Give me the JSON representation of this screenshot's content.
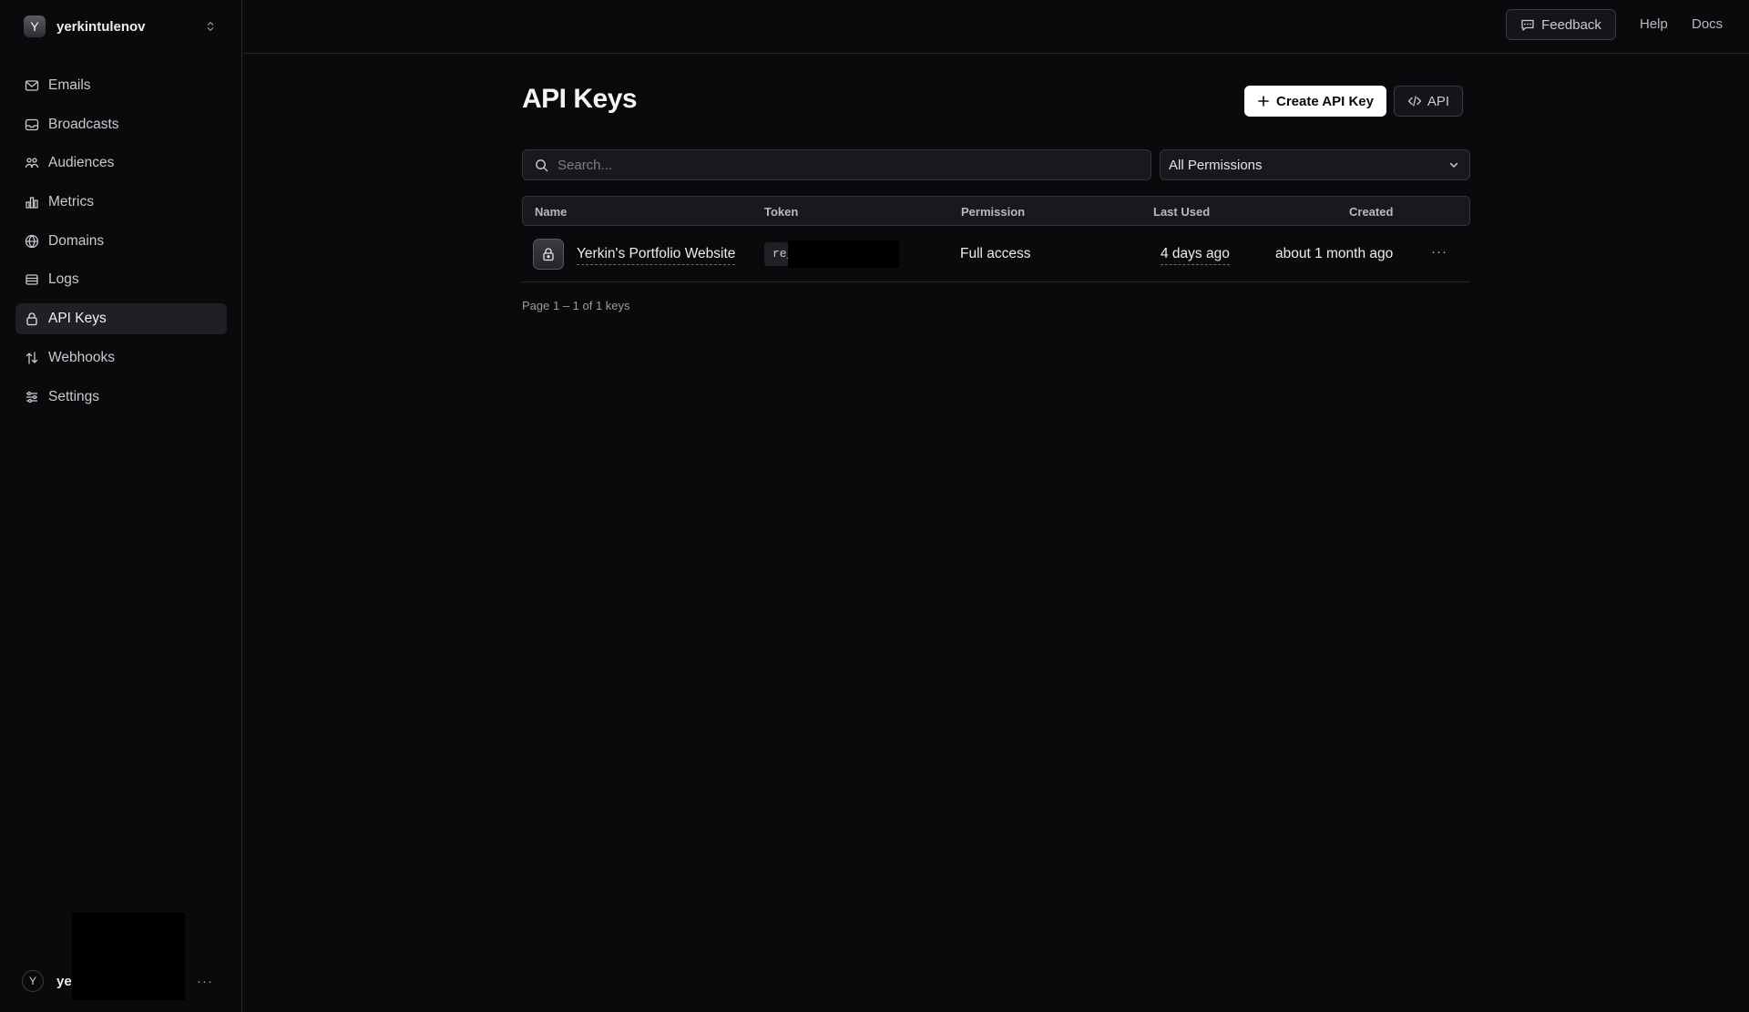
{
  "sidebar": {
    "team_initial": "Y",
    "team_name": "yerkintulenov",
    "items": [
      {
        "label": "Emails",
        "icon": "mail-icon"
      },
      {
        "label": "Broadcasts",
        "icon": "inbox-icon"
      },
      {
        "label": "Audiences",
        "icon": "users-icon"
      },
      {
        "label": "Metrics",
        "icon": "bar-chart-icon"
      },
      {
        "label": "Domains",
        "icon": "globe-icon"
      },
      {
        "label": "Logs",
        "icon": "logs-icon"
      },
      {
        "label": "API Keys",
        "icon": "lock-icon",
        "active": true
      },
      {
        "label": "Webhooks",
        "icon": "arrows-icon"
      },
      {
        "label": "Settings",
        "icon": "sliders-icon"
      }
    ],
    "user_initial": "Y",
    "user_name": "ye",
    "more": "···"
  },
  "topbar": {
    "feedback": "Feedback",
    "help": "Help",
    "docs": "Docs"
  },
  "main": {
    "title": "API Keys",
    "create_button": "Create API Key",
    "api_button": "API",
    "search_placeholder": "Search...",
    "permission_filter": "All Permissions",
    "columns": [
      "Name",
      "Token",
      "Permission",
      "Last Used",
      "Created"
    ],
    "rows": [
      {
        "name": "Yerkin's Portfolio Website",
        "token_prefix": "re_",
        "permission": "Full access",
        "last_used": "4 days ago",
        "created": "about 1 month ago",
        "more": "···"
      }
    ],
    "pagination": "Page 1 – 1 of 1 keys"
  },
  "colors": {
    "background": "#0a0a0c",
    "active_nav": "#1f2024",
    "primary_button": "#ffffff"
  }
}
